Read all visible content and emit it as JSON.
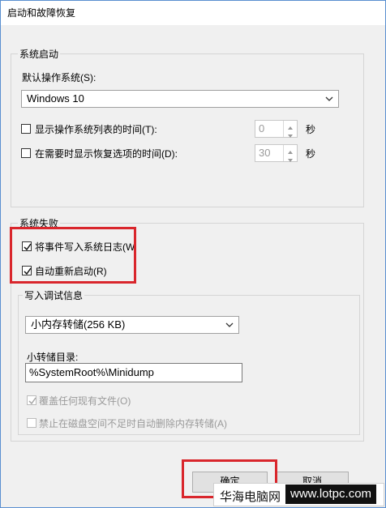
{
  "window": {
    "title": "启动和故障恢复"
  },
  "system_startup": {
    "legend": "系统启动",
    "default_os_label": "默认操作系统(S):",
    "default_os_value": "Windows 10",
    "show_os_list_label": "显示操作系统列表的时间(T):",
    "show_os_list_checked": false,
    "show_os_list_value": "0",
    "show_recovery_label": "在需要时显示恢复选项的时间(D):",
    "show_recovery_checked": false,
    "show_recovery_value": "30",
    "seconds_unit": "秒"
  },
  "system_failure": {
    "legend": "系统失败",
    "write_event_label": "将事件写入系统日志(W",
    "write_event_checked": true,
    "auto_restart_label": "自动重新启动(R)",
    "auto_restart_checked": true
  },
  "debug_info": {
    "legend": "写入调试信息",
    "dump_type_value": "小内存转储(256 KB)",
    "dump_dir_label": "小转储目录:",
    "dump_dir_value": "%SystemRoot%\\Minidump",
    "overwrite_label": "覆盖任何现有文件(O)",
    "overwrite_checked": true,
    "disable_auto_delete_label": "禁止在磁盘空间不足时自动删除内存转储(A)",
    "disable_auto_delete_checked": false
  },
  "buttons": {
    "ok": "确定",
    "cancel": "取消"
  },
  "watermark": {
    "site_name": "华海电脑网",
    "url": "www.lotpc.com"
  },
  "colors": {
    "highlight_box": "#d9262c",
    "window_bg": "#f0f0f0"
  }
}
